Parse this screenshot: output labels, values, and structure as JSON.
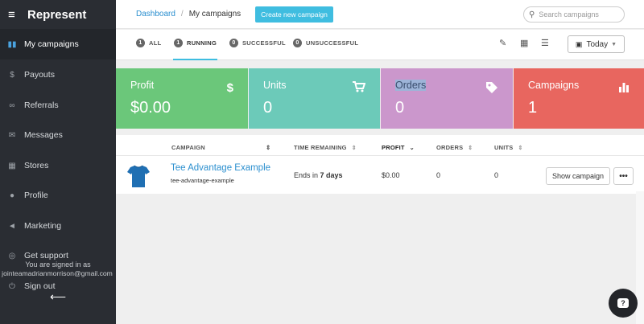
{
  "sidebar": {
    "brand": "Represent",
    "items": [
      {
        "label": "My campaigns",
        "icon": "bar-chart-icon"
      },
      {
        "label": "Payouts",
        "icon": "dollar-icon"
      },
      {
        "label": "Referrals",
        "icon": "link-icon"
      },
      {
        "label": "Messages",
        "icon": "envelope-icon"
      },
      {
        "label": "Stores",
        "icon": "grid-icon"
      },
      {
        "label": "Profile",
        "icon": "user-icon"
      },
      {
        "label": "Marketing",
        "icon": "megaphone-icon"
      },
      {
        "label": "Get support",
        "icon": "lifebuoy-icon"
      },
      {
        "label": "Sign out",
        "icon": "power-icon"
      }
    ],
    "signed_in_text": "You are signed in as",
    "email": "jointeamadrianmorrison@gmail.com"
  },
  "topbar": {
    "breadcrumb_link": "Dashboard",
    "breadcrumb_sep": "/",
    "breadcrumb_current": "My campaigns",
    "create_button": "Create new campaign",
    "search_placeholder": "Search campaigns"
  },
  "filters": [
    {
      "count": "1",
      "label": "ALL"
    },
    {
      "count": "1",
      "label": "RUNNING"
    },
    {
      "count": "0",
      "label": "SUCCESSFUL"
    },
    {
      "count": "0",
      "label": "UNSUCCESSFUL"
    }
  ],
  "date_filter": "Today",
  "stats": [
    {
      "title": "Profit",
      "value": "$0.00",
      "icon": "$",
      "color": "#6bc77a"
    },
    {
      "title": "Units",
      "value": "0",
      "icon": "cart-icon",
      "color": "#6ccab9"
    },
    {
      "title": "Orders",
      "value": "0",
      "icon": "tag-icon",
      "color": "#cb97cc"
    },
    {
      "title": "Campaigns",
      "value": "1",
      "icon": "bar-chart-icon",
      "color": "#e8665f"
    }
  ],
  "table": {
    "headers": [
      "CAMPAIGN",
      "TIME REMAINING",
      "PROFIT",
      "ORDERS",
      "UNITS"
    ],
    "rows": [
      {
        "name": "Tee Advantage Example",
        "slug": "tee-advantage-example",
        "time_prefix": "Ends in ",
        "time_bold": "7 days",
        "profit": "$0.00",
        "orders": "0",
        "units": "0",
        "action": "Show campaign",
        "more": "•••"
      }
    ]
  }
}
